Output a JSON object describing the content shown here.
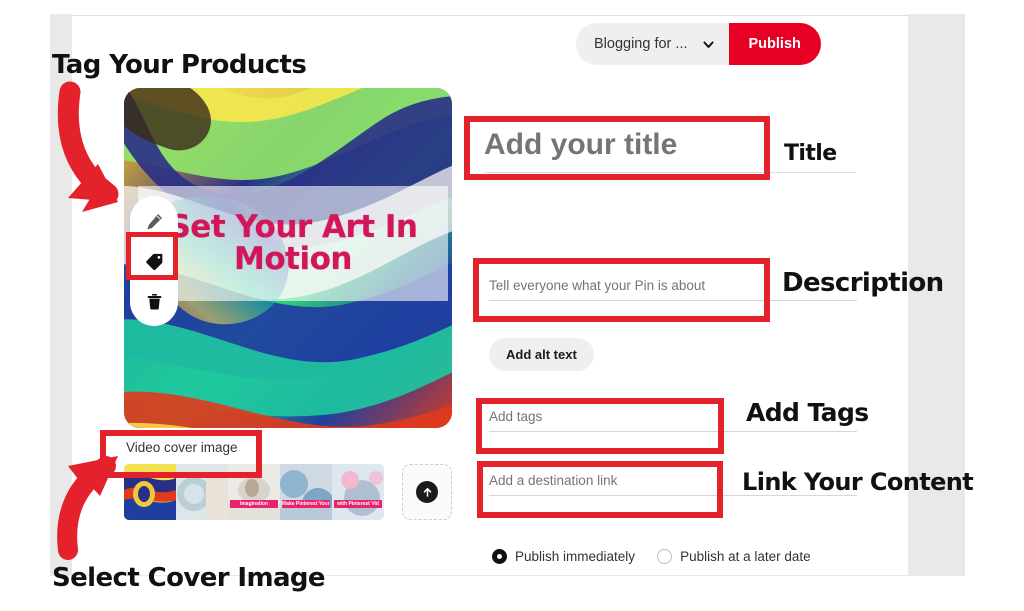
{
  "topbar": {
    "board_label": "Blogging for ...",
    "chevron_icon": "chevron-down-icon",
    "publish_label": "Publish"
  },
  "media": {
    "overlay_line1": "Set Your Art In",
    "overlay_line2": "Motion",
    "tools": [
      {
        "name": "pencil-icon",
        "label": "Edit"
      },
      {
        "name": "tag-icon",
        "label": "Tag products"
      },
      {
        "name": "trash-icon",
        "label": "Delete"
      }
    ]
  },
  "cover": {
    "label": "Video cover image",
    "upload_icon": "upload-arrow-icon",
    "thumbnails": [
      {
        "ribbon": ""
      },
      {
        "ribbon": ""
      },
      {
        "ribbon": "Imagination"
      },
      {
        "ribbon": "Make Pinterest Your Best Move"
      },
      {
        "ribbon": "with Pinterest Vid"
      }
    ]
  },
  "form": {
    "title": {
      "value": "",
      "placeholder": "Add your title"
    },
    "description": {
      "value": "",
      "placeholder": "Tell everyone what your Pin is about"
    },
    "alt_text_button": "Add alt text",
    "tags": {
      "value": "",
      "placeholder": "Add tags"
    },
    "link": {
      "value": "",
      "placeholder": "Add a destination link"
    }
  },
  "schedule": {
    "options": [
      {
        "label": "Publish immediately",
        "selected": true
      },
      {
        "label": "Publish at a later date",
        "selected": false
      }
    ]
  },
  "annotations": {
    "tag_products": "Tag Your Products",
    "select_cover": "Select Cover Image",
    "title": "Title",
    "description": "Description",
    "add_tags": "Add Tags",
    "link_content": "Link Your Content"
  },
  "colors": {
    "brand_red": "#e60023",
    "annotation_red": "#e3222b",
    "overlay_pink": "#d1175a",
    "gutter_gray": "#e9e9e9"
  }
}
